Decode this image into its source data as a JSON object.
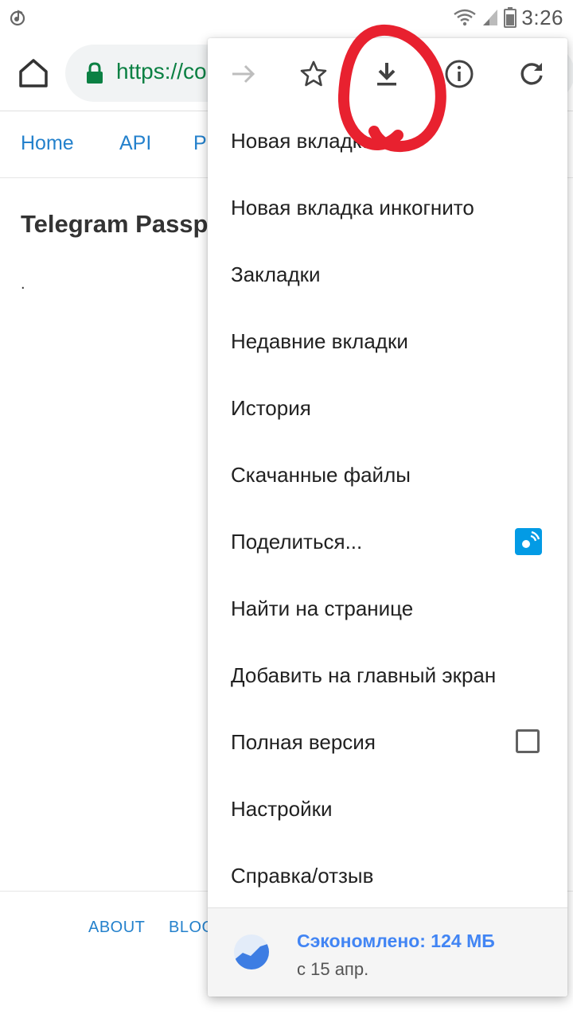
{
  "status": {
    "time": "3:26"
  },
  "toolbar": {
    "url": "https://co"
  },
  "site_nav": {
    "items": [
      "Home",
      "API",
      "P"
    ]
  },
  "page": {
    "title": "Telegram Passp",
    "dot": "."
  },
  "footer": {
    "links": [
      "ABOUT",
      "BLOG"
    ]
  },
  "menu": {
    "top_icons": [
      "forward-arrow-icon",
      "star-icon",
      "download-icon",
      "info-icon",
      "reload-icon"
    ],
    "items": [
      {
        "label": "Новая вкладка"
      },
      {
        "label": "Новая вкладка инкогнито"
      },
      {
        "label": "Закладки"
      },
      {
        "label": "Недавние вкладки"
      },
      {
        "label": "История"
      },
      {
        "label": "Скачанные файлы"
      },
      {
        "label": "Поделиться..."
      },
      {
        "label": "Найти на странице"
      },
      {
        "label": "Добавить на главный экран"
      },
      {
        "label": "Полная версия"
      },
      {
        "label": "Настройки"
      },
      {
        "label": "Справка/отзыв"
      }
    ],
    "full_version_checked": false,
    "saver": {
      "title": "Сэкономлено: 124 МБ",
      "subtitle": "с 15 апр."
    }
  },
  "colors": {
    "link": "#2481cc",
    "secure_url": "#0b8043",
    "saver_title": "#4285f4",
    "annotation": "#e8212f",
    "share_badge": "#039be5"
  }
}
